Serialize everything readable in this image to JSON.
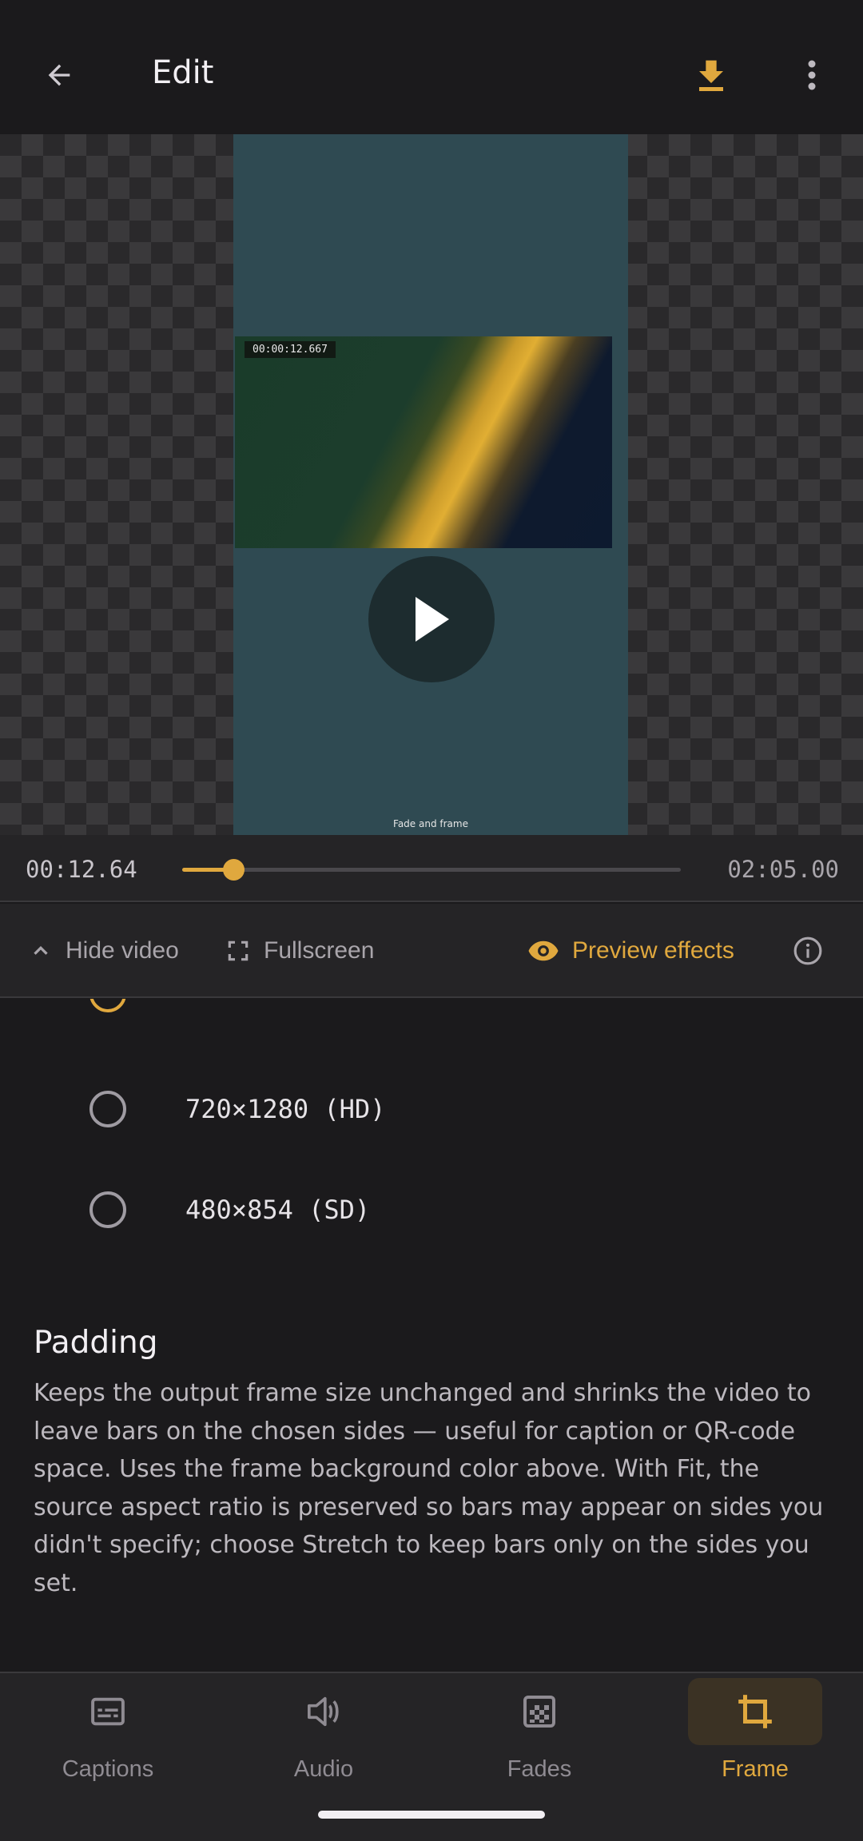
{
  "colors": {
    "accent": "#e0a83e",
    "background": "#1b1a1c",
    "surface": "#252426"
  },
  "appbar": {
    "title": "Edit",
    "back_icon": "arrow-left-icon",
    "download_icon": "download-icon",
    "more_icon": "more-vertical-icon"
  },
  "preview": {
    "timecode": "00:00:12.667",
    "frame_caption": "Fade and frame",
    "play_icon": "play-icon"
  },
  "seek": {
    "current": "00:12.64",
    "duration": "02:05.00",
    "progress": 0.102
  },
  "controls": {
    "hide_video": "Hide video",
    "fullscreen": "Fullscreen",
    "preview_effects": "Preview effects",
    "info_icon": "info-icon"
  },
  "resolution_options": [
    {
      "label": "720×1280 (HD)",
      "selected": false
    },
    {
      "label": "480×854 (SD)",
      "selected": false
    }
  ],
  "padding": {
    "title": "Padding",
    "description": "Keeps the output frame size unchanged and shrinks the video to leave bars on the chosen sides — useful for caption or QR-code space. Uses the frame background color above. With Fit, the source aspect ratio is preserved so bars may appear on sides you didn't specify; choose Stretch to keep bars only on the sides you set."
  },
  "bottom_nav": [
    {
      "label": "Captions",
      "icon": "captions-icon",
      "active": false
    },
    {
      "label": "Audio",
      "icon": "volume-icon",
      "active": false
    },
    {
      "label": "Fades",
      "icon": "fades-icon",
      "active": false
    },
    {
      "label": "Frame",
      "icon": "crop-icon",
      "active": true
    }
  ]
}
